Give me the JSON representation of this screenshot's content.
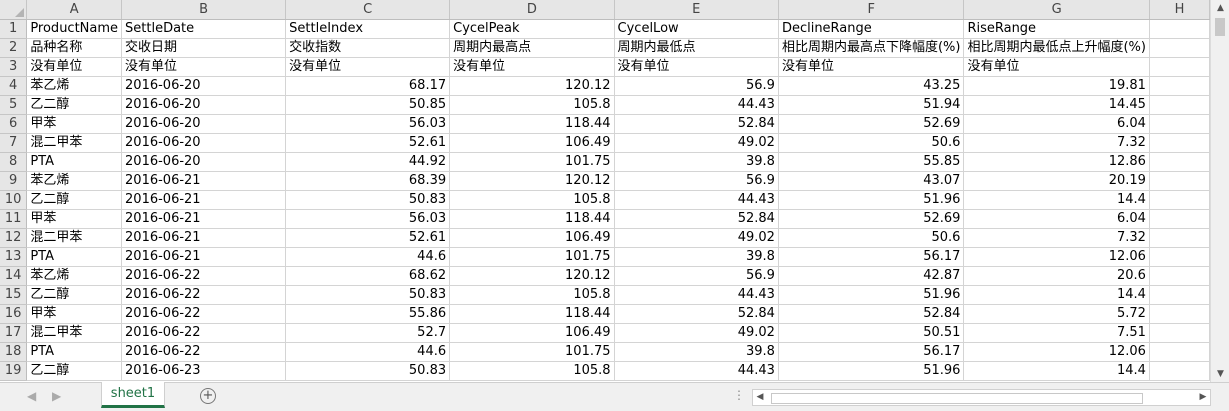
{
  "columns": [
    "A",
    "B",
    "C",
    "D",
    "E",
    "F",
    "G",
    "H"
  ],
  "row_numbers": [
    "1",
    "2",
    "3",
    "4",
    "5",
    "6",
    "7",
    "8",
    "9",
    "10",
    "11",
    "12",
    "13",
    "14",
    "15",
    "16",
    "17",
    "18",
    "19"
  ],
  "header_rows": [
    [
      "ProductName",
      "SettleDate",
      "SettleIndex",
      "CycelPeak",
      "CycelLow",
      "DeclineRange",
      "RiseRange",
      ""
    ],
    [
      "品种名称",
      "交收日期",
      "交收指数",
      "周期内最高点",
      "周期内最低点",
      "相比周期内最高点下降幅度(%)",
      "相比周期内最低点上升幅度(%)",
      ""
    ],
    [
      "没有单位",
      "没有单位",
      "没有单位",
      "没有单位",
      "没有单位",
      "没有单位",
      "没有单位",
      ""
    ]
  ],
  "data_rows": [
    [
      "苯乙烯",
      "2016-06-20",
      "68.17",
      "120.12",
      "56.9",
      "43.25",
      "19.81",
      ""
    ],
    [
      "乙二醇",
      "2016-06-20",
      "50.85",
      "105.8",
      "44.43",
      "51.94",
      "14.45",
      ""
    ],
    [
      "甲苯",
      "2016-06-20",
      "56.03",
      "118.44",
      "52.84",
      "52.69",
      "6.04",
      ""
    ],
    [
      "混二甲苯",
      "2016-06-20",
      "52.61",
      "106.49",
      "49.02",
      "50.6",
      "7.32",
      ""
    ],
    [
      "PTA",
      "2016-06-20",
      "44.92",
      "101.75",
      "39.8",
      "55.85",
      "12.86",
      ""
    ],
    [
      "苯乙烯",
      "2016-06-21",
      "68.39",
      "120.12",
      "56.9",
      "43.07",
      "20.19",
      ""
    ],
    [
      "乙二醇",
      "2016-06-21",
      "50.83",
      "105.8",
      "44.43",
      "51.96",
      "14.4",
      ""
    ],
    [
      "甲苯",
      "2016-06-21",
      "56.03",
      "118.44",
      "52.84",
      "52.69",
      "6.04",
      ""
    ],
    [
      "混二甲苯",
      "2016-06-21",
      "52.61",
      "106.49",
      "49.02",
      "50.6",
      "7.32",
      ""
    ],
    [
      "PTA",
      "2016-06-21",
      "44.6",
      "101.75",
      "39.8",
      "56.17",
      "12.06",
      ""
    ],
    [
      "苯乙烯",
      "2016-06-22",
      "68.62",
      "120.12",
      "56.9",
      "42.87",
      "20.6",
      ""
    ],
    [
      "乙二醇",
      "2016-06-22",
      "50.83",
      "105.8",
      "44.43",
      "51.96",
      "14.4",
      ""
    ],
    [
      "甲苯",
      "2016-06-22",
      "55.86",
      "118.44",
      "52.84",
      "52.84",
      "5.72",
      ""
    ],
    [
      "混二甲苯",
      "2016-06-22",
      "52.7",
      "106.49",
      "49.02",
      "50.51",
      "7.51",
      ""
    ],
    [
      "PTA",
      "2016-06-22",
      "44.6",
      "101.75",
      "39.8",
      "56.17",
      "12.06",
      ""
    ],
    [
      "乙二醇",
      "2016-06-23",
      "50.83",
      "105.8",
      "44.43",
      "51.96",
      "14.4",
      ""
    ]
  ],
  "sheet_tab": "sheet1",
  "add_sheet_icon": "plus-circle-icon",
  "scroll_up_glyph": "▲",
  "scroll_down_glyph": "▼",
  "scroll_left_glyph": "◀",
  "scroll_right_glyph": "▶",
  "tab_prev_glyph": "◀",
  "tab_next_glyph": "▶",
  "dots": "⋮",
  "accent_color": "#217346"
}
